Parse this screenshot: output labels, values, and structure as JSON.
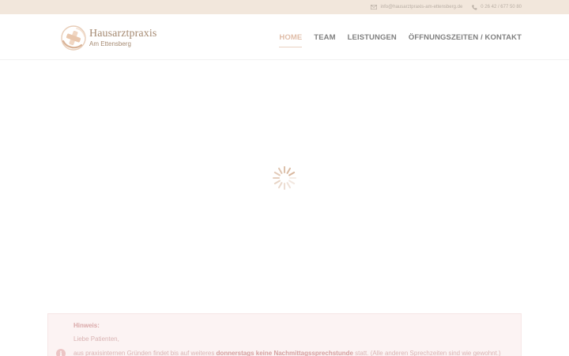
{
  "topbar": {
    "email": "info@hausarztpraxis-am-ettensberg.de",
    "phone": "0 26 42 / 677 50 80"
  },
  "logo": {
    "title": "Hausarztpraxis",
    "subtitle": "Am Ettensberg"
  },
  "nav": {
    "items": [
      {
        "label": "HOME"
      },
      {
        "label": "TEAM"
      },
      {
        "label": "LEISTUNGEN"
      },
      {
        "label": "ÖFFNUNGSZEITEN / KONTAKT"
      }
    ],
    "active_index": 0
  },
  "notice": {
    "title": "Hinweis:",
    "greeting": "Liebe Patienten,",
    "text_before": "aus praxisinternen Gründen findet bis auf weiteres ",
    "text_bold": "donnerstags keine Nachmittagssprechstunde",
    "text_after": " statt. (Alle anderen Sprechzeiten sind wie gewohnt.)",
    "icon": "info-icon"
  },
  "colors": {
    "accent": "#e0bda8",
    "topbar_bg": "#f2e7dc",
    "notice_bg": "#fcf3f3",
    "logo": "#a58a72"
  }
}
